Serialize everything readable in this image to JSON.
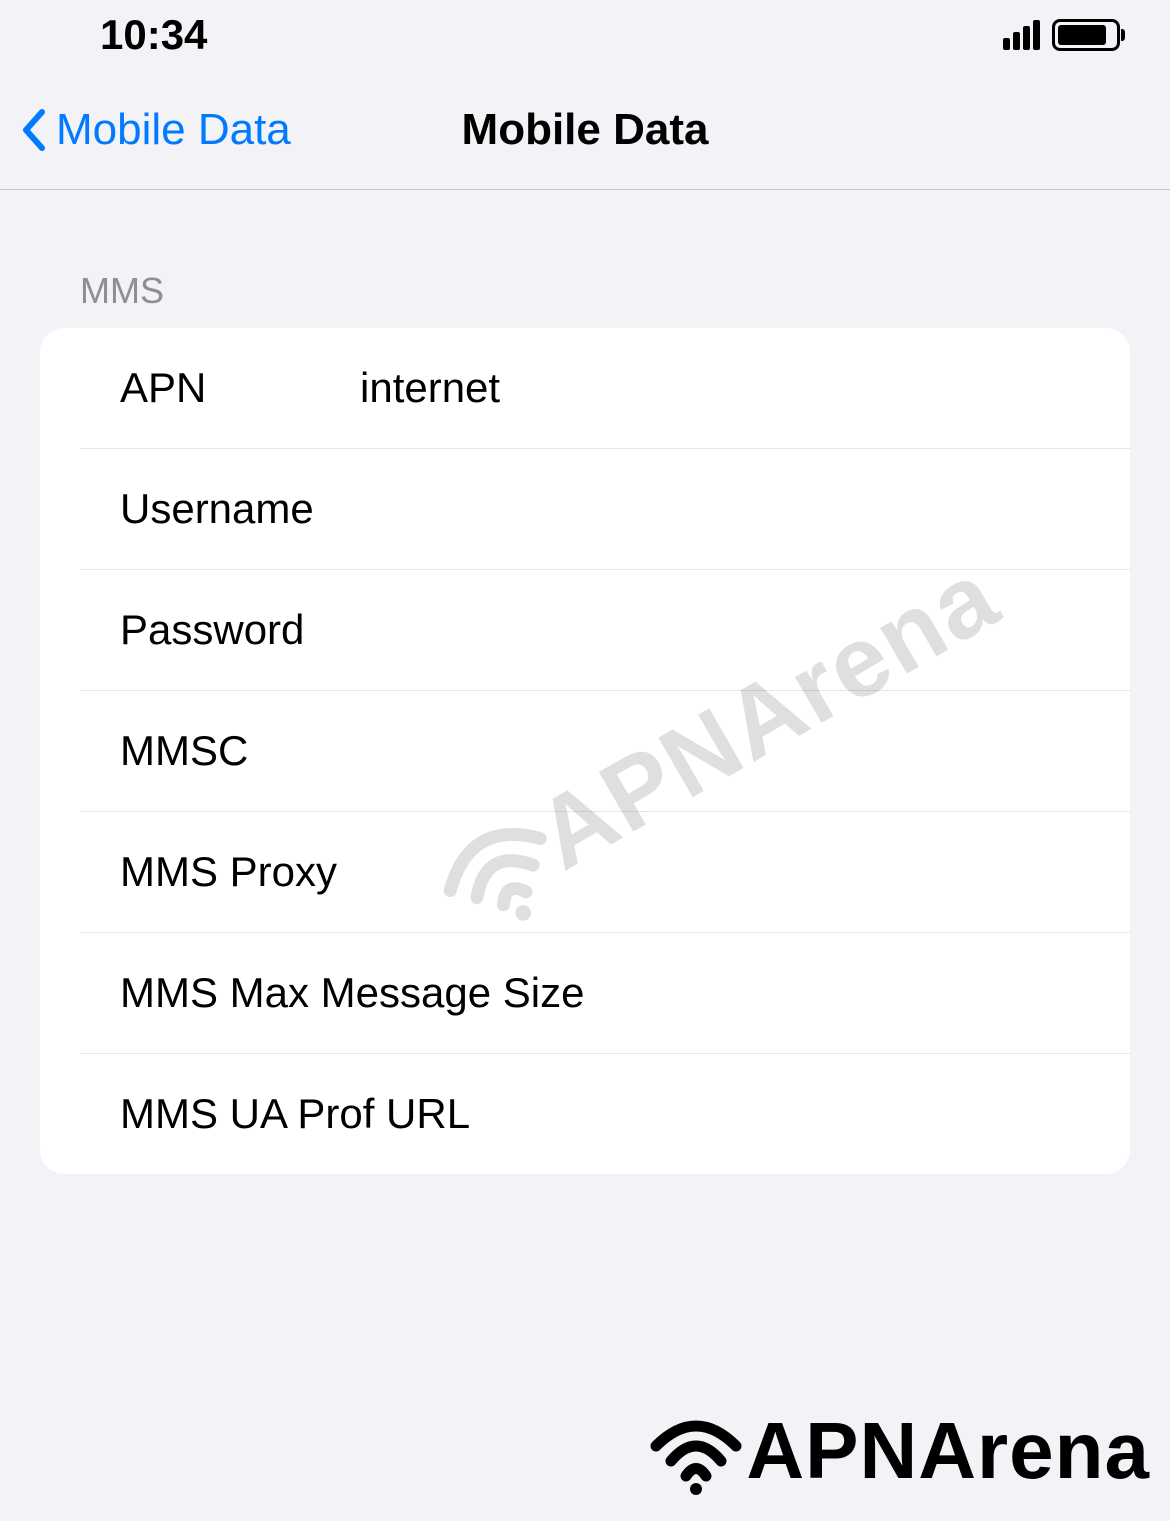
{
  "status_bar": {
    "time": "10:34"
  },
  "nav": {
    "back_label": "Mobile Data",
    "title": "Mobile Data"
  },
  "section": {
    "header": "MMS",
    "rows": [
      {
        "label": "APN",
        "value": "internet"
      },
      {
        "label": "Username",
        "value": ""
      },
      {
        "label": "Password",
        "value": ""
      },
      {
        "label": "MMSC",
        "value": ""
      },
      {
        "label": "MMS Proxy",
        "value": ""
      },
      {
        "label": "MMS Max Message Size",
        "value": ""
      },
      {
        "label": "MMS UA Prof URL",
        "value": ""
      }
    ]
  },
  "watermark": {
    "text": "APNArena"
  },
  "brand": {
    "text": "APNArena"
  }
}
